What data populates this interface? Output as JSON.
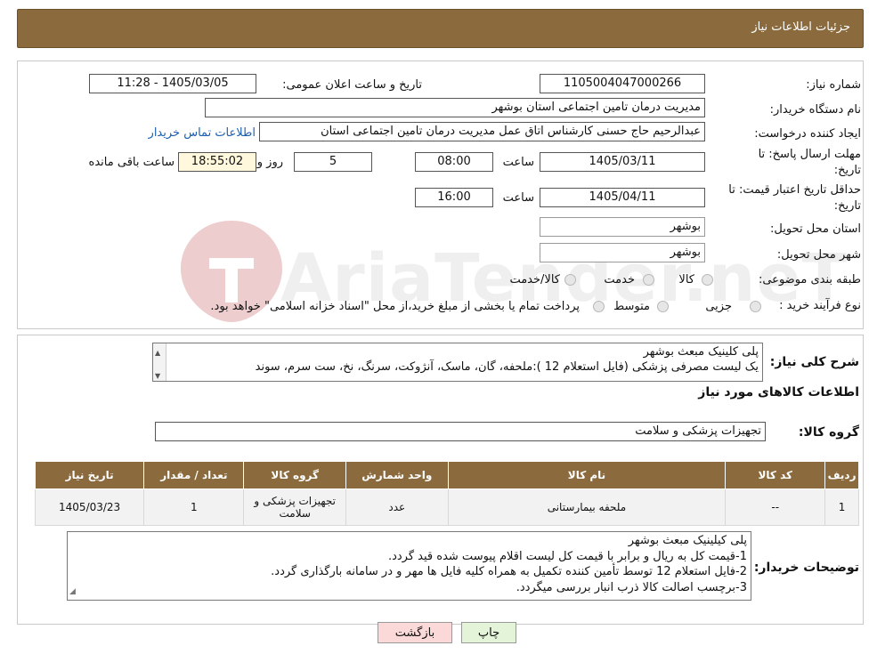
{
  "header": {
    "title": "جزئیات اطلاعات نیاز"
  },
  "form": {
    "need_number_label": "شماره نیاز:",
    "need_number": "1105004047000266",
    "announce_label": "تاریخ و ساعت اعلان عمومی:",
    "announce_value": "1405/03/05 - 11:28",
    "buyer_org_label": "نام دستگاه خریدار:",
    "buyer_org": "مدیریت درمان تامین اجتماعی استان بوشهر",
    "creator_label": "ایجاد کننده درخواست:",
    "creator": "عبدالرحیم حاج حسنی کارشناس اتاق عمل مدیریت درمان تامین اجتماعی استان",
    "contact_link": "اطلاعات تماس خریدار",
    "deadline_label_1": "مهلت ارسال پاسخ: تا",
    "deadline_label_2": "تاریخ:",
    "deadline_date": "1405/03/11",
    "time_label": "ساعت",
    "deadline_time": "08:00",
    "days_value": "5",
    "days_label": "روز و",
    "remaining_time": "18:55:02",
    "remaining_label": "ساعت باقی مانده",
    "price_validity_label_1": "حداقل تاریخ اعتبار قیمت: تا",
    "price_validity_label_2": "تاریخ:",
    "price_validity_date": "1405/04/11",
    "price_validity_time": "16:00",
    "province_label": "استان محل تحویل:",
    "province": "بوشهر",
    "city_label": "شهر محل تحویل:",
    "city": "بوشهر",
    "category_label": "طبقه بندی موضوعی:",
    "category_options": [
      "کالا",
      "خدمت",
      "کالا/خدمت"
    ],
    "process_label": "نوع فرآیند خرید :",
    "process_options": [
      "جزیی",
      "متوسط"
    ],
    "process_note": "پرداخت تمام یا بخشی از مبلغ خرید،از محل \"اسناد خزانه اسلامی\" خواهد بود."
  },
  "summary": {
    "label": "شرح کلی نیاز:",
    "line1": "پلی کلینیک مبعث بوشهر",
    "line2": "یک لیست مصرفی پزشکی (فایل استعلام 12 ):ملحفه، گان، ماسک، آنژوکت، سرنگ، نخ، ست سرم، سوند"
  },
  "goods_info_title": "اطلاعات کالاهای مورد نیاز",
  "goods_group": {
    "label": "گروه کالا:",
    "value": "تجهیزات پزشکی و سلامت"
  },
  "table": {
    "headers": [
      "ردیف",
      "کد کالا",
      "نام کالا",
      "واحد شمارش",
      "گروه کالا",
      "تعداد / مقدار",
      "تاریخ نیاز"
    ],
    "rows": [
      {
        "row": "1",
        "code": "--",
        "name": "ملحفه بیمارستانی",
        "unit": "عدد",
        "group": "تجهیزات پزشکی و سلامت",
        "qty": "1",
        "date": "1405/03/23"
      }
    ]
  },
  "buyer_notes": {
    "label": "توضیحات خریدار:",
    "lines": [
      "پلی کیلینیک مبعث بوشهر",
      "1-قیمت کل به ریال و برابر با قیمت کل لیست اقلام پیوست شده قید گردد.",
      "2-فایل استعلام 12 توسط تأمین کننده تکمیل به همراه کلیه فایل ها مهر و در سامانه بارگذاری گردد.",
      "3-برچسب اصالت کالا ذرب انبار بررسی میگردد."
    ]
  },
  "buttons": {
    "print": "چاپ",
    "back": "بازگشت"
  },
  "watermark": {
    "text": "AriaTender.neT"
  },
  "colors": {
    "header_bg": "#8b6b3e",
    "link": "#1b5fb0",
    "remaining_bg": "#fff8dc",
    "back_bg": "#fbd9d9",
    "print_bg": "#e3f4d9"
  }
}
